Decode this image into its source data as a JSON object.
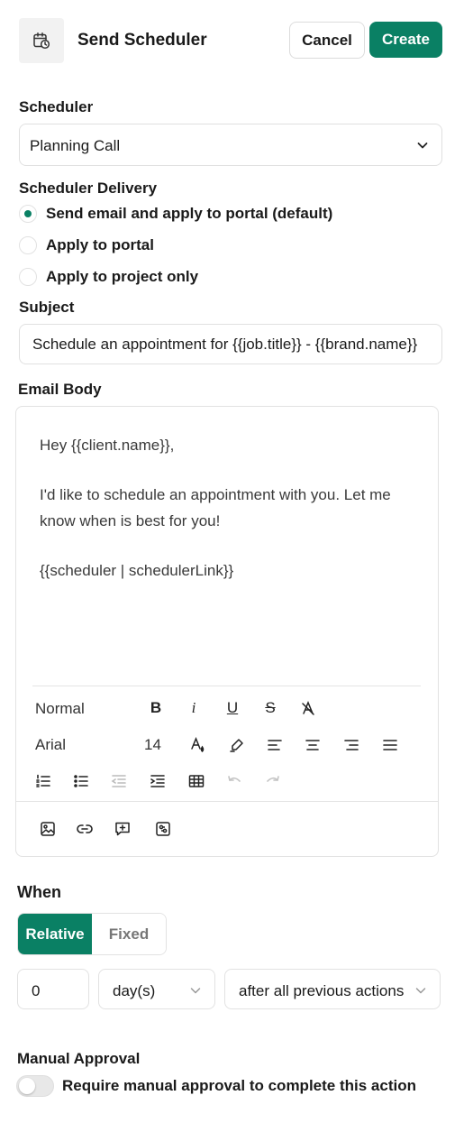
{
  "header": {
    "title": "Send Scheduler",
    "icon": "calendar-clock-icon",
    "cancel_label": "Cancel",
    "create_label": "Create"
  },
  "colors": {
    "accent": "#0a8064"
  },
  "scheduler": {
    "label": "Scheduler",
    "selected": "Planning Call"
  },
  "delivery": {
    "label": "Scheduler Delivery",
    "options": [
      {
        "label": "Send email and apply to portal (default)",
        "checked": true
      },
      {
        "label": "Apply to portal",
        "checked": false
      },
      {
        "label": "Apply to project only",
        "checked": false
      }
    ]
  },
  "subject": {
    "label": "Subject",
    "value": "Schedule an appointment for {{job.title}} - {{brand.name}}"
  },
  "email_body": {
    "label": "Email Body",
    "lines": [
      "Hey {{client.name}},",
      "I'd like to schedule an appointment with you. Let me know when is best for you!",
      "{{scheduler | schedulerLink}}"
    ],
    "toolbar": {
      "heading": "Normal",
      "font": "Arial",
      "size": "14"
    }
  },
  "when": {
    "label": "When",
    "modes": [
      "Relative",
      "Fixed"
    ],
    "active_mode": "Relative",
    "amount": "0",
    "unit": "day(s)",
    "trigger": "after all previous actions"
  },
  "manual_approval": {
    "label": "Manual Approval",
    "toggle_label": "Require manual approval to complete this action",
    "enabled": false
  }
}
